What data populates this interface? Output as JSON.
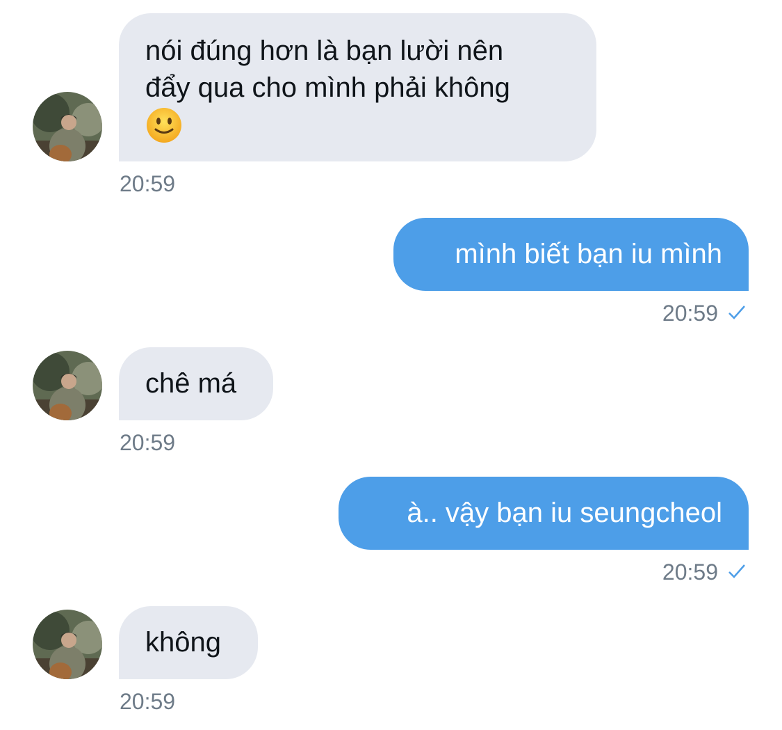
{
  "conversation": {
    "messages": [
      {
        "direction": "received",
        "lines": [
          "nói đúng hơn là bạn lười nên",
          "đẩy qua cho mình phải không"
        ],
        "emoji": "slightly-smiling-face-icon",
        "time": "20:59"
      },
      {
        "direction": "sent",
        "text": "mình biết bạn iu mình",
        "time": "20:59",
        "status_icon": "check-icon"
      },
      {
        "direction": "received",
        "text": "chê má",
        "time": "20:59"
      },
      {
        "direction": "sent",
        "text": "à.. vậy bạn iu seungcheol",
        "time": "20:59",
        "status_icon": "check-icon"
      },
      {
        "direction": "received",
        "text": "không",
        "time": "20:59"
      }
    ]
  },
  "colors": {
    "received_bubble": "#e6e9f0",
    "sent_bubble": "#4d9ee8",
    "timestamp": "#6e7b88",
    "check": "#4d9ee8"
  }
}
